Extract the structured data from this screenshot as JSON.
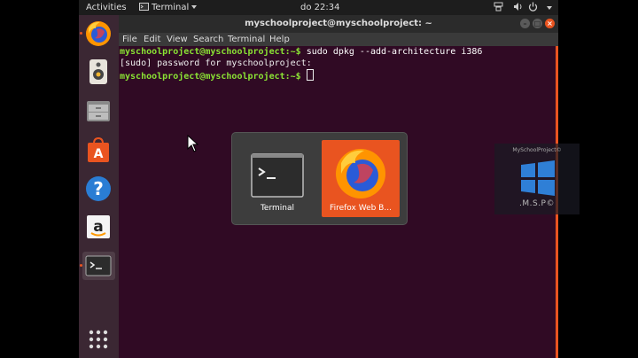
{
  "top_panel": {
    "activities": "Activities",
    "app_menu": "Terminal",
    "clock": "do 22:34"
  },
  "window": {
    "title": "myschoolproject@myschoolproject: ~",
    "menu": [
      "File",
      "Edit",
      "View",
      "Search",
      "Terminal",
      "Help"
    ]
  },
  "terminal": {
    "prompt": "myschoolproject@myschoolproject:~$",
    "command": " sudo dpkg --add-architecture i386",
    "password_prompt": "[sudo] password for myschoolproject:"
  },
  "dock": {
    "items": [
      "firefox-icon",
      "speaker-icon",
      "files-icon",
      "software-store-icon",
      "help-icon",
      "amazon-icon",
      "terminal-icon",
      "app-grid-icon"
    ]
  },
  "switcher": {
    "items": [
      {
        "label": "Terminal",
        "selected": false
      },
      {
        "label": "Firefox Web B...",
        "selected": true
      }
    ]
  },
  "watermark": {
    "top": "MySchoolProject©",
    "bottom": ".M.S.P©"
  },
  "colors": {
    "terminal_bg": "#300a24",
    "prompt_green": "#8ae234",
    "selection_orange": "#e95420"
  }
}
